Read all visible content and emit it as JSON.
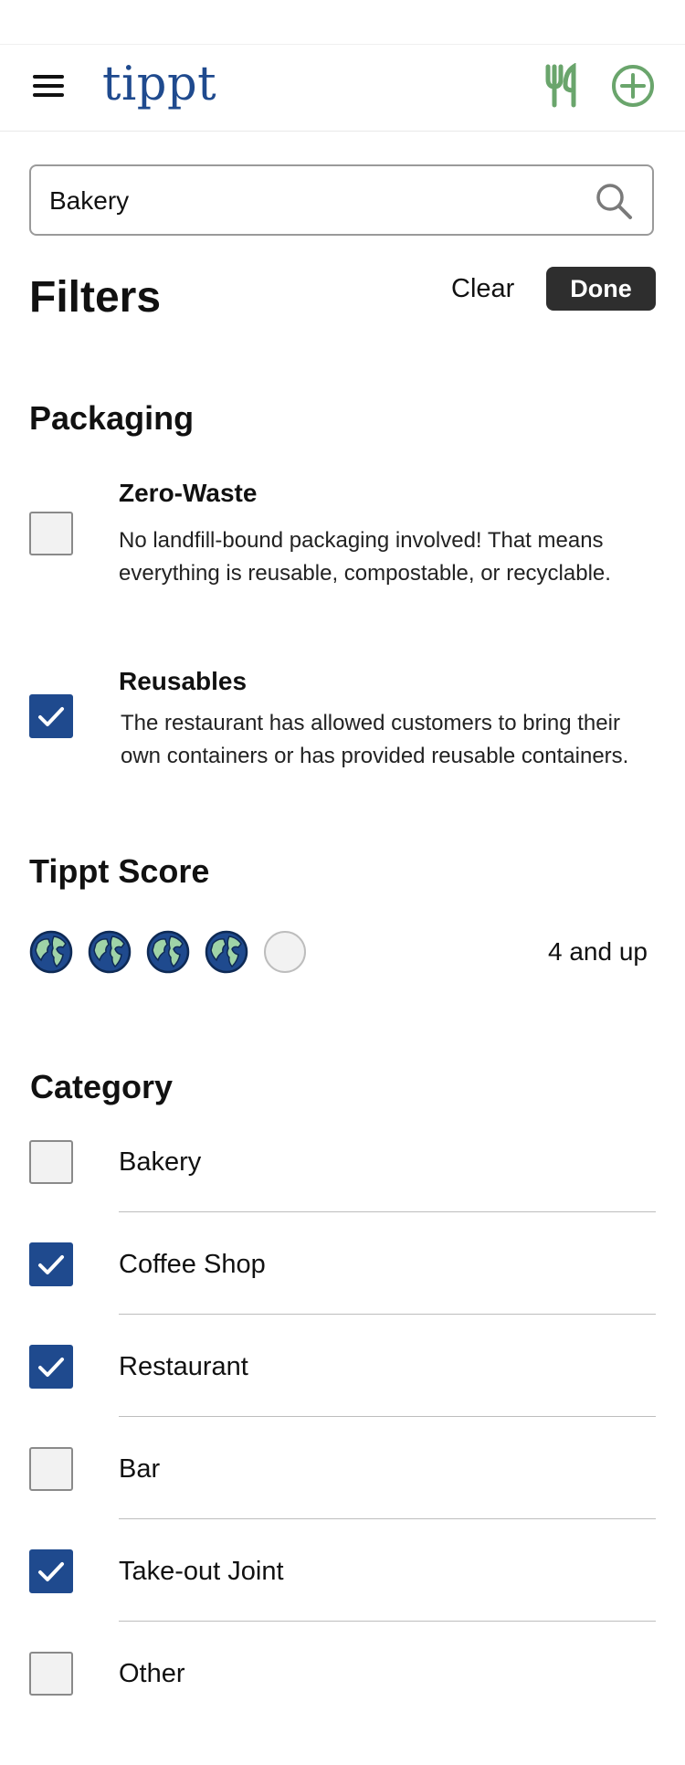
{
  "header": {
    "logo": "tippt",
    "icons": [
      "menu-icon",
      "fork-knife-icon",
      "add-circle-icon"
    ],
    "colors": {
      "brand": "#1f4a8e",
      "accent_green": "#6aa56c"
    }
  },
  "search": {
    "value": "Bakery",
    "icon": "search-icon"
  },
  "filters": {
    "title": "Filters",
    "clear_label": "Clear",
    "done_label": "Done"
  },
  "packaging": {
    "title": "Packaging",
    "options": [
      {
        "title": "Zero-Waste",
        "description": "No landfill-bound packaging involved! That means everything is reusable, compostable, or recyclable.",
        "checked": false
      },
      {
        "title": "Reusables",
        "description": "The restaurant has allowed customers to bring their own containers or has provided reusable containers.",
        "checked": true
      }
    ]
  },
  "tippt_score": {
    "title": "Tippt Score",
    "max": 5,
    "selected": 4,
    "label": "4 and up"
  },
  "category": {
    "title": "Category",
    "items": [
      {
        "label": "Bakery",
        "checked": false
      },
      {
        "label": "Coffee Shop",
        "checked": true
      },
      {
        "label": "Restaurant",
        "checked": true
      },
      {
        "label": "Bar",
        "checked": false
      },
      {
        "label": "Take-out Joint",
        "checked": true
      },
      {
        "label": "Other",
        "checked": false
      }
    ]
  }
}
